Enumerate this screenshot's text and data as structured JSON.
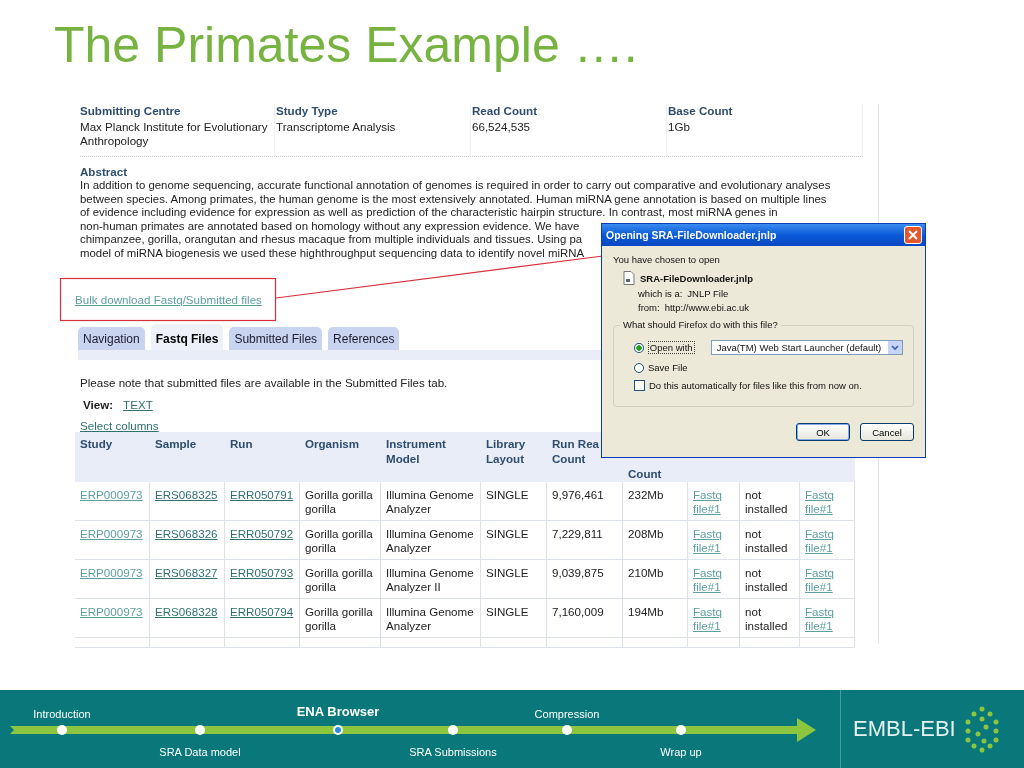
{
  "title": "The Primates Example ….",
  "study": {
    "fields": [
      {
        "label": "Submitting Centre",
        "value": "Max Planck Institute for Evolutionary Anthropology"
      },
      {
        "label": "Study Type",
        "value": "Transcriptome Analysis"
      },
      {
        "label": "Read Count",
        "value": "66,524,535"
      },
      {
        "label": "Base Count",
        "value": "1Gb"
      }
    ],
    "abstract_label": "Abstract",
    "abstract_lines": [
      "In addition to genome sequencing, accurate functional annotation of genomes is required in order to carry out comparative and evolutionary analyses",
      "between species. Among primates, the human genome is the most extensively annotated. Human miRNA gene annotation is based on multiple lines",
      "of evidence including evidence for expression as well as prediction of the characteristic hairpin structure. In contrast, most miRNA genes in",
      "non-human primates are annotated based on homology without any expression evidence. We have",
      "chimpanzee, gorilla, orangutan and rhesus macaque from multiple individuals and tissues. Using pa",
      "model of miRNA biogenesis we used these highthroughput sequencing data to identify novel miRNA"
    ]
  },
  "bulk_link": "Bulk download Fastq/Submitted files",
  "tabs": [
    {
      "label": "Navigation",
      "selected": false
    },
    {
      "label": "Fastq Files",
      "selected": true
    },
    {
      "label": "Submitted Files",
      "selected": false
    },
    {
      "label": "References",
      "selected": false
    }
  ],
  "note": "Please note that submitted files are available in the Submitted Files tab.",
  "view": {
    "label": "View:",
    "link": "TEXT"
  },
  "select_columns": "Select columns",
  "table": {
    "columns": [
      {
        "header": [
          "Study"
        ],
        "kind": "visited-link"
      },
      {
        "header": [
          "Sample"
        ],
        "kind": "link"
      },
      {
        "header": [
          "Run"
        ],
        "kind": "link"
      },
      {
        "header": [
          "Organism"
        ],
        "kind": "text"
      },
      {
        "header": [
          "Instrument",
          "Model"
        ],
        "kind": "text"
      },
      {
        "header": [
          "Library",
          "Layout"
        ],
        "kind": "text"
      },
      {
        "header": [
          "Run Rea",
          "Count"
        ],
        "kind": "text"
      },
      {
        "header": [
          "Count"
        ],
        "kind": "text"
      },
      {
        "kind": "visited-link"
      },
      {
        "kind": "text"
      },
      {
        "kind": "visited-link"
      }
    ],
    "rows": [
      [
        "ERP000973",
        "ERS068325",
        "ERR050791",
        "Gorilla gorilla gorilla",
        "Illumina Genome Analyzer",
        "SINGLE",
        "9,976,461",
        "232Mb",
        "Fastq file#1",
        "not installed",
        "Fastq file#1"
      ],
      [
        "ERP000973",
        "ERS068326",
        "ERR050792",
        "Gorilla gorilla gorilla",
        "Illumina Genome Analyzer",
        "SINGLE",
        "7,229,811",
        "208Mb",
        "Fastq file#1",
        "not installed",
        "Fastq file#1"
      ],
      [
        "ERP000973",
        "ERS068327",
        "ERR050793",
        "Gorilla gorilla gorilla",
        "Illumina Genome Analyzer II",
        "SINGLE",
        "9,039,875",
        "210Mb",
        "Fastq file#1",
        "not installed",
        "Fastq file#1"
      ],
      [
        "ERP000973",
        "ERS068328",
        "ERR050794",
        "Gorilla gorilla gorilla",
        "Illumina Genome Analyzer",
        "SINGLE",
        "7,160,009",
        "194Mb",
        "Fastq file#1",
        "not installed",
        "Fastq file#1"
      ]
    ]
  },
  "dialog": {
    "title": "Opening SRA-FileDownloader.jnlp",
    "intro": "You have chosen to open",
    "file_name": "SRA-FileDownloader.jnlp",
    "type_label": "which is a:",
    "type_value": "JNLP File",
    "from_label": "from:",
    "from_value": "http://www.ebi.ac.uk",
    "question": "What should Firefox do with this file?",
    "options": [
      {
        "kind": "radio",
        "label": "Open with",
        "selected": true,
        "app": "Java(TM) Web Start Launcher (default)"
      },
      {
        "kind": "radio",
        "label": "Save File",
        "selected": false
      },
      {
        "kind": "checkbox",
        "label": "Do this automatically for files like this from now on.",
        "checked": false
      }
    ],
    "buttons": [
      "OK",
      "Cancel"
    ]
  },
  "footer": {
    "steps": [
      {
        "label": "Introduction",
        "kind": "above",
        "selected": false
      },
      {
        "label": "SRA Data model",
        "kind": "below",
        "selected": false
      },
      {
        "label": "ENA Browser",
        "kind": "above",
        "selected": true
      },
      {
        "label": "SRA Submissions",
        "kind": "below",
        "selected": false
      },
      {
        "label": "Compression",
        "kind": "above",
        "selected": false
      },
      {
        "label": "Wrap up",
        "kind": "below",
        "selected": false
      }
    ],
    "logo": "EMBL-EBI"
  }
}
